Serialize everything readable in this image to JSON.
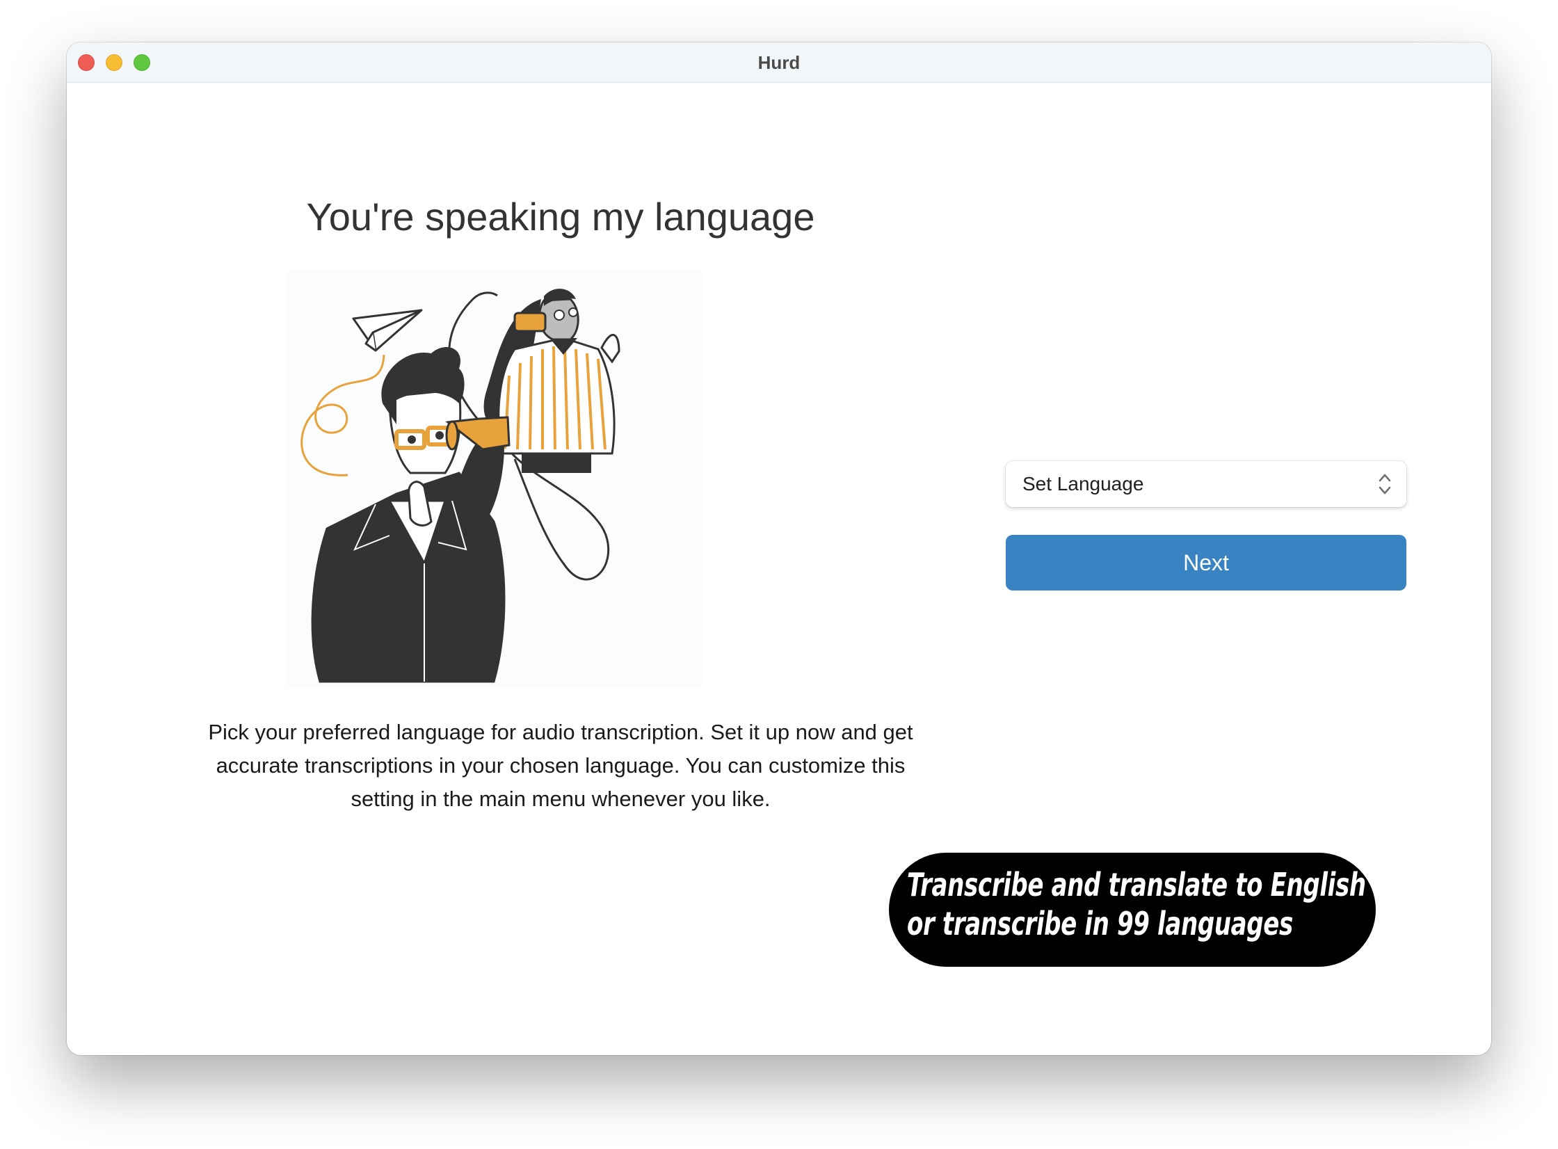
{
  "window": {
    "title": "Hurd"
  },
  "onboarding": {
    "heading": "You're speaking my language",
    "description": "Pick your preferred language for audio transcription. Set it up now and get accurate transcriptions in your chosen language. You can customize this setting in the main menu whenever you like.",
    "illustration": "two-people-talking-through-tin-can-phone",
    "language_select": {
      "value": "Set Language",
      "icon": "up-down-chevron-icon"
    },
    "next_label": "Next"
  },
  "promo": {
    "line1": "Transcribe and translate to English",
    "line2": "or transcribe in 99 languages"
  },
  "colors": {
    "accent": "#3a83c3",
    "illustration_orange": "#e8a23c",
    "illustration_dark": "#333333",
    "titlebar": "#f3f6f8"
  }
}
